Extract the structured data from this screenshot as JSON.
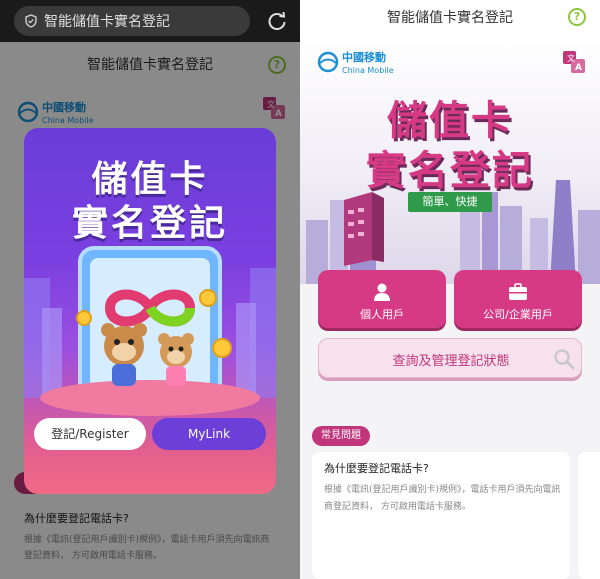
{
  "browser": {
    "url_text": "智能儲值卡實名登記"
  },
  "header": {
    "title": "智能儲值卡實名登記",
    "help_glyph": "?"
  },
  "brand": {
    "name_zh": "中國移動",
    "name_en": "China Mobile"
  },
  "modal": {
    "title_line1": "儲值卡",
    "title_line2": "實名登記",
    "register_button": "登記/Register",
    "mylink_button": "MyLink"
  },
  "hero": {
    "title_line1": "儲值卡",
    "title_line2": "實名登記",
    "tagline": "簡單、快捷"
  },
  "actions": {
    "personal": "個人用戶",
    "company": "公司/企業用戶",
    "query": "查詢及管理登記狀態"
  },
  "faq": {
    "badge": "常見問題",
    "question": "為什麼要登記電話卡?",
    "answer": "根據《電訊(登記用戶識別卡)規例》，電話卡用戶須先向電訊商登記資料， 方可啟用電話卡服務。",
    "answer_left": "根據《電訊(登記用戶識別卡)規例》，電話卡用戶須先向電訊商登記資料， 方可啟用電話卡服務。"
  },
  "colors": {
    "brand_pink": "#d63a84",
    "modal_purple": "#6b3fd8",
    "help_green": "#8cc63f",
    "tag_green": "#2e9a4a"
  },
  "icons": [
    "shield-icon",
    "reload-icon",
    "help-icon",
    "china-mobile-logo",
    "language-icon",
    "person-icon",
    "briefcase-icon",
    "search-icon"
  ]
}
